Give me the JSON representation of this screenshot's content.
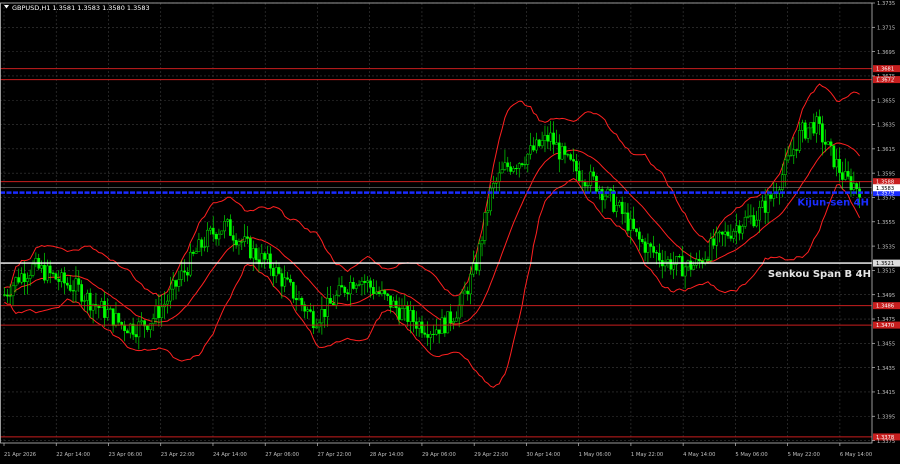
{
  "header": {
    "symbol_line": "GBPUSD,H1  1.3581 1.3583 1.3580 1.3583"
  },
  "colors": {
    "background": "#000000",
    "grid": "#3c3c3c",
    "axis": "#bfbfbf",
    "bull_candle": "#00ff00",
    "bear_candle": "#00ff00",
    "bollinger": "#ff2020",
    "level_line": "#c81e1e",
    "kijun_line": "#1a2cff",
    "senkou_line": "#ffffff",
    "price_tag": "#ffffff"
  },
  "chart_data": {
    "type": "candlestick",
    "title": "GBPUSD,H1",
    "ylim": [
      1.3373,
      1.3735
    ],
    "yticks": [
      "1.3735",
      "1.3715",
      "1.3695",
      "1.3675",
      "1.3655",
      "1.3635",
      "1.3615",
      "1.3595",
      "1.3575",
      "1.3555",
      "1.3535",
      "1.3515",
      "1.3495",
      "1.3475",
      "1.3455",
      "1.3435",
      "1.3415",
      "1.3395",
      "1.3375"
    ],
    "xticks": [
      "21 Apr 2026",
      "22 Apr 14:00",
      "23 Apr 06:00",
      "23 Apr 22:00",
      "24 Apr 14:00",
      "27 Apr 06:00",
      "27 Apr 22:00",
      "28 Apr 14:00",
      "29 Apr 06:00",
      "29 Apr 22:00",
      "30 Apr 14:00",
      "1 May 06:00",
      "1 May 22:00",
      "4 May 14:00",
      "5 May 06:00",
      "5 May 22:00",
      "6 May 14:00"
    ],
    "price_path": [
      1.3495,
      1.351,
      1.3518,
      1.3512,
      1.3505,
      1.35,
      1.3488,
      1.348,
      1.347,
      1.3468,
      1.3475,
      1.349,
      1.351,
      1.353,
      1.3545,
      1.3552,
      1.354,
      1.3528,
      1.352,
      1.3505,
      1.349,
      1.3475,
      1.3485,
      1.35,
      1.351,
      1.35,
      1.349,
      1.348,
      1.3472,
      1.3466,
      1.3472,
      1.3488,
      1.352,
      1.358,
      1.36,
      1.3606,
      1.3615,
      1.3625,
      1.3606,
      1.3595,
      1.3588,
      1.3575,
      1.356,
      1.354,
      1.353,
      1.3522,
      1.3518,
      1.352,
      1.3535,
      1.3545,
      1.3555,
      1.356,
      1.3575,
      1.36,
      1.3628,
      1.3636,
      1.3612,
      1.359,
      1.3583
    ],
    "levels": [
      {
        "value": 1.3681,
        "label": "1.3681",
        "kind": "resistance"
      },
      {
        "value": 1.3672,
        "label": "1.3672",
        "kind": "resistance"
      },
      {
        "value": 1.3588,
        "label": "1.3588",
        "kind": "resistance"
      },
      {
        "value": 1.3486,
        "label": "1.3486",
        "kind": "support"
      },
      {
        "value": 1.347,
        "label": "1.3470",
        "kind": "support"
      },
      {
        "value": 1.3378,
        "label": "1.3378",
        "kind": "support"
      }
    ],
    "kijun": {
      "value": 1.3579,
      "label": "1.3579",
      "name": "Kijun-sen 4H"
    },
    "senkou": {
      "value": 1.3521,
      "label": "1.3521",
      "name": "Senkou Span B 4H"
    },
    "current_price": {
      "value": 1.3583,
      "label": "1.3583"
    }
  }
}
